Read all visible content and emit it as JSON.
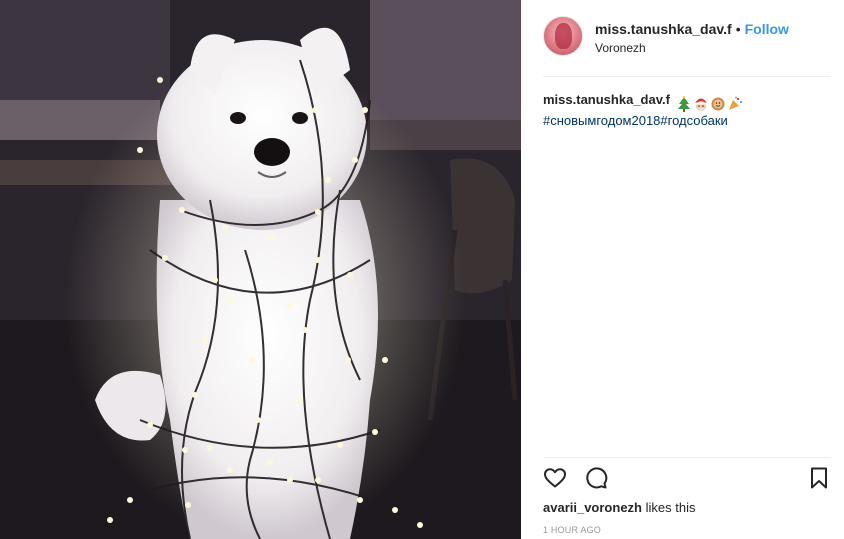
{
  "post": {
    "username": "miss.tanushka_dav.f",
    "separator": "•",
    "follow_label": "Follow",
    "location": "Voronezh",
    "caption_user": "miss.tanushka_dav.f",
    "caption_emojis": [
      "christmas-tree-emoji",
      "santa-emoji",
      "gingerbread-emoji",
      "party-popper-emoji"
    ],
    "hashtags": "#сновымгодом2018#годсобаки",
    "liker": "avarii_voronezh",
    "likes_suffix": " likes this",
    "timestamp": "1 HOUR AGO"
  },
  "icons": {
    "like": "heart-icon",
    "comment": "comment-icon",
    "save": "bookmark-icon"
  },
  "colors": {
    "follow": "#3897f0",
    "hashtag": "#003569",
    "text": "#262626",
    "muted": "#999999"
  }
}
